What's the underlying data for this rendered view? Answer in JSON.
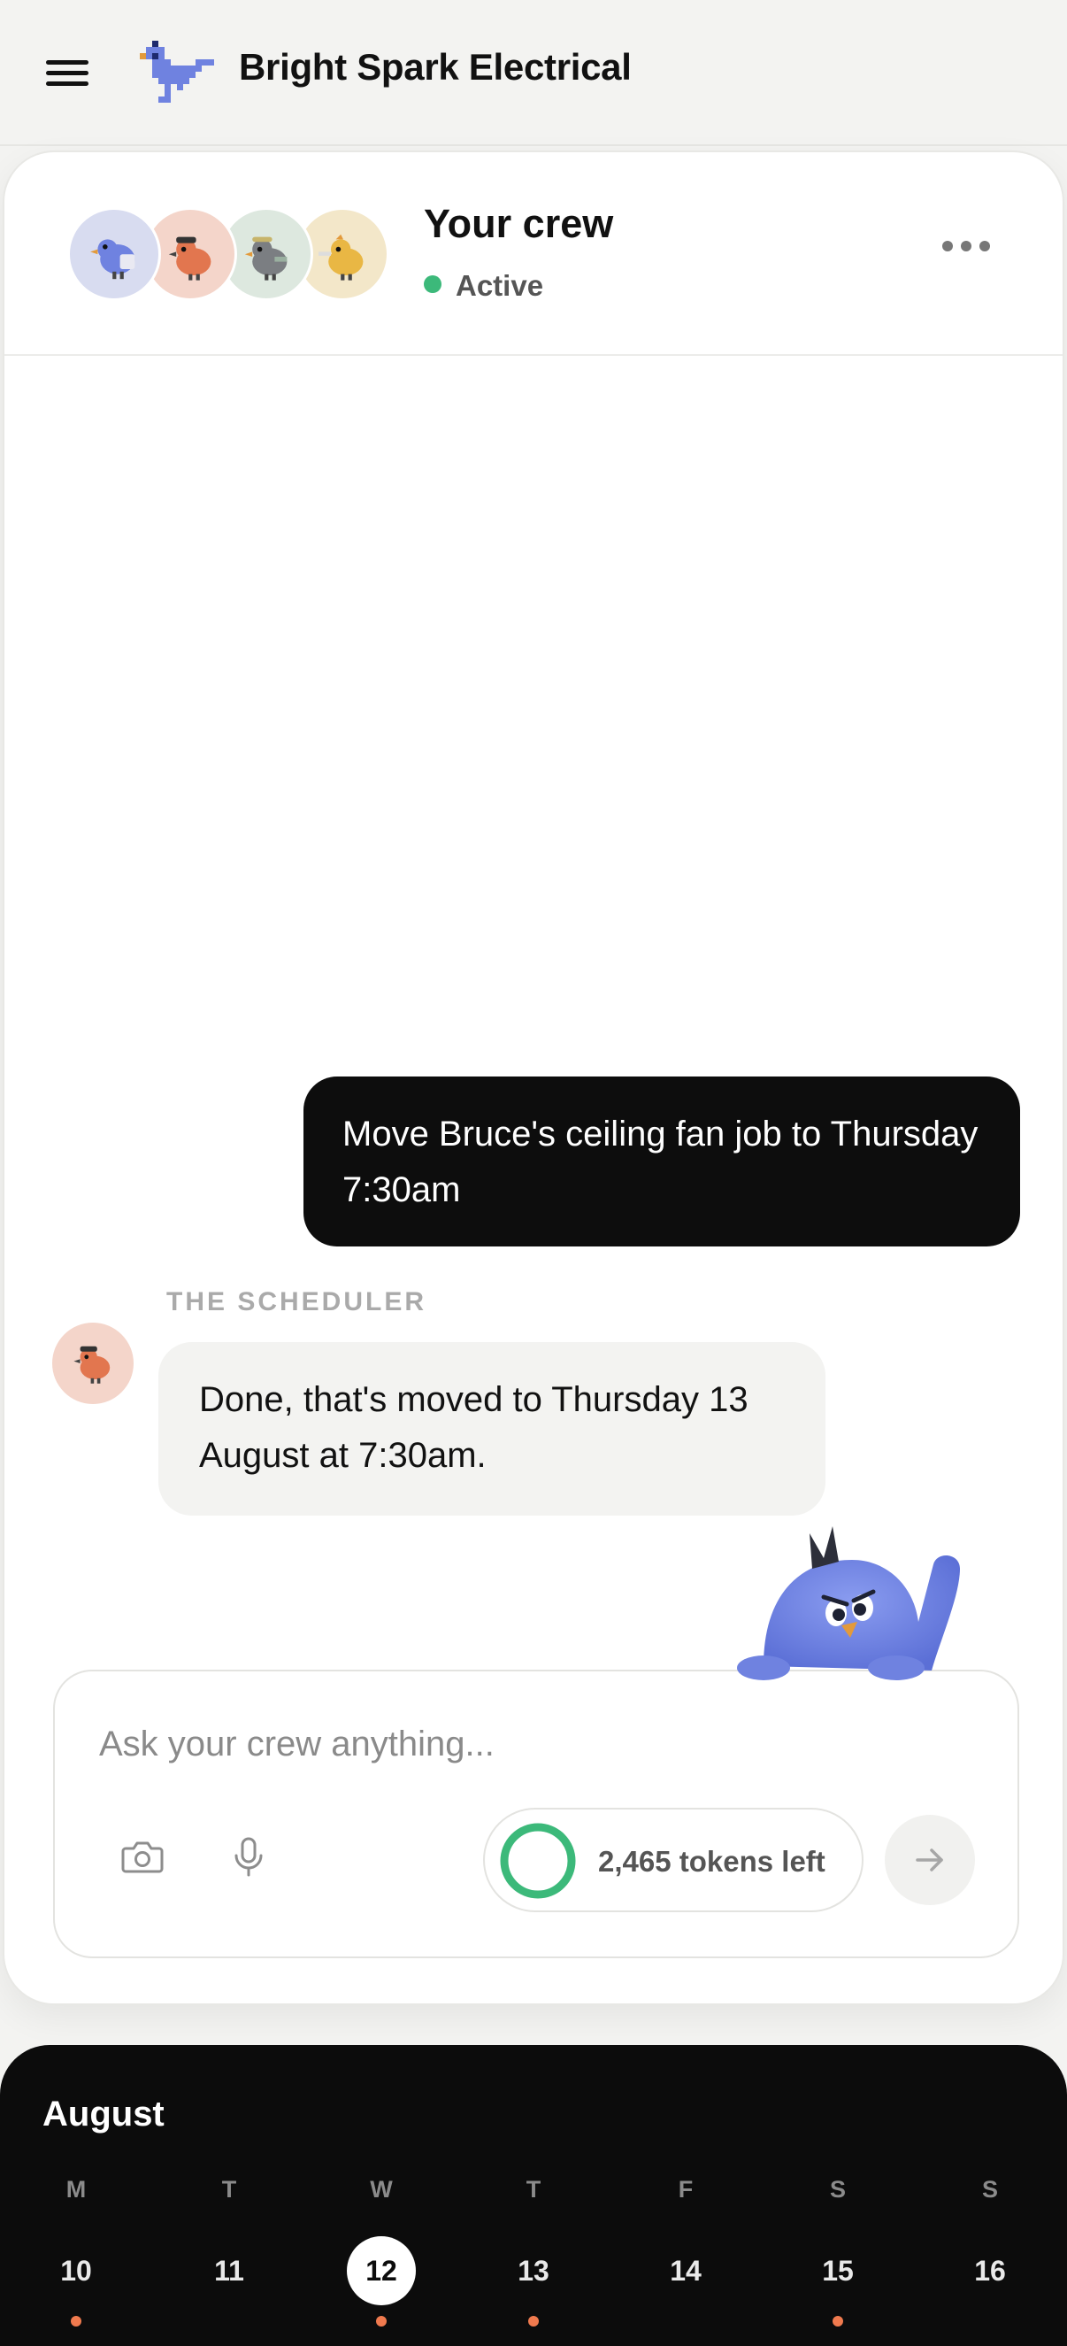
{
  "header": {
    "title": "Bright Spark Electrical",
    "menu_icon": "hamburger-menu-icon",
    "logo_icon": "pixel-bird-logo-icon"
  },
  "crew": {
    "title": "Your crew",
    "status": "Active",
    "status_color": "#3cb97a",
    "avatars": [
      {
        "icon": "blue-bird-avatar-icon",
        "bg": "#d8dcf0"
      },
      {
        "icon": "orange-bird-avatar-icon",
        "bg": "#f4d5ca"
      },
      {
        "icon": "grey-bird-avatar-icon",
        "bg": "#dde8df"
      },
      {
        "icon": "yellow-bird-avatar-icon",
        "bg": "#f3e7c9"
      }
    ],
    "more_icon": "more-dots-icon"
  },
  "messages": [
    {
      "role": "user",
      "text": "Move Bruce's ceiling fan job to Thursday 7:30am"
    },
    {
      "role": "assistant",
      "sender": "THE SCHEDULER",
      "text": "Done, that's moved to Thursday 13 August at 7:30am."
    }
  ],
  "composer": {
    "placeholder": "Ask your crew anything...",
    "value": "",
    "tokens_label": "2,465 tokens left",
    "camera_icon": "camera-icon",
    "mic_icon": "microphone-icon",
    "send_icon": "arrow-right-icon"
  },
  "calendar": {
    "month": "August",
    "days": [
      {
        "dow": "M",
        "date": "10",
        "selected": false,
        "has_event": true
      },
      {
        "dow": "T",
        "date": "11",
        "selected": false,
        "has_event": false
      },
      {
        "dow": "W",
        "date": "12",
        "selected": true,
        "has_event": true
      },
      {
        "dow": "T",
        "date": "13",
        "selected": false,
        "has_event": true
      },
      {
        "dow": "F",
        "date": "14",
        "selected": false,
        "has_event": false
      },
      {
        "dow": "S",
        "date": "15",
        "selected": false,
        "has_event": true
      },
      {
        "dow": "S",
        "date": "16",
        "selected": false,
        "has_event": false
      }
    ],
    "event_dot_color": "#f07a4e"
  },
  "colors": {
    "accent_blue": "#7083e0",
    "token_ring": "#3cb97a"
  }
}
